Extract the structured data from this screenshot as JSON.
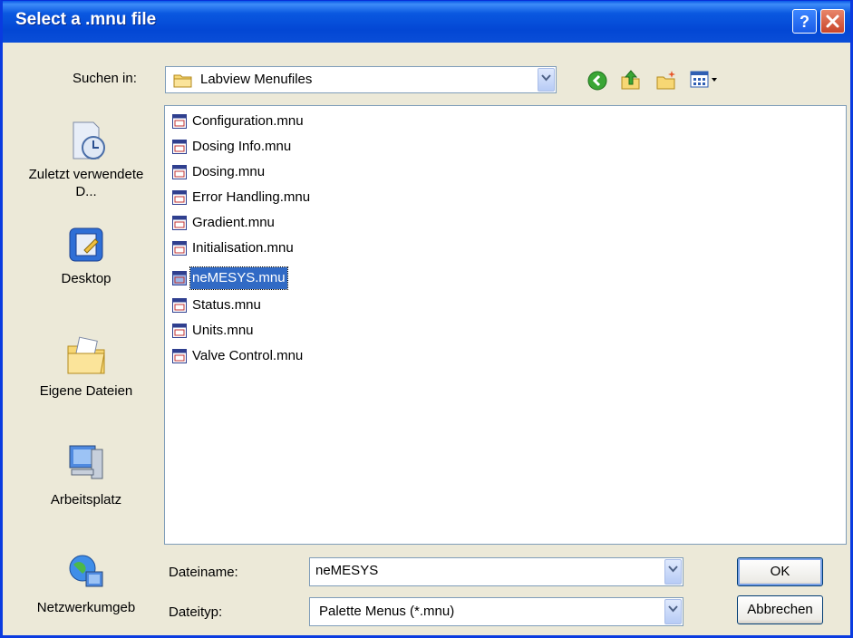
{
  "window": {
    "title": "Select a .mnu file"
  },
  "toolbar": {
    "look_in_label": "Suchen in:",
    "look_in_value": "Labview Menufiles"
  },
  "places": [
    {
      "label": "Zuletzt verwendete D...",
      "icon": "recent-documents-icon"
    },
    {
      "label": "Desktop",
      "icon": "desktop-icon"
    },
    {
      "label": "Eigene Dateien",
      "icon": "my-documents-icon"
    },
    {
      "label": "Arbeitsplatz",
      "icon": "my-computer-icon"
    },
    {
      "label": "Netzwerkumgeb",
      "icon": "network-icon"
    }
  ],
  "files": [
    {
      "name": "Configuration.mnu",
      "selected": false
    },
    {
      "name": "Dosing Info.mnu",
      "selected": false
    },
    {
      "name": "Dosing.mnu",
      "selected": false
    },
    {
      "name": "Error Handling.mnu",
      "selected": false
    },
    {
      "name": "Gradient.mnu",
      "selected": false
    },
    {
      "name": "Initialisation.mnu",
      "selected": false
    },
    {
      "name": "neMESYS.mnu",
      "selected": true
    },
    {
      "name": "Status.mnu",
      "selected": false
    },
    {
      "name": "Units.mnu",
      "selected": false
    },
    {
      "name": "Valve Control.mnu",
      "selected": false
    }
  ],
  "filename": {
    "label": "Dateiname:",
    "value": "neMESYS"
  },
  "filetype": {
    "label": "Dateityp:",
    "value": "Palette Menus (*.mnu)"
  },
  "buttons": {
    "ok": "OK",
    "cancel": "Abbrechen"
  },
  "colors": {
    "titlebar": "#0347d4",
    "selection": "#316ac5",
    "dialog_bg": "#ece9d8"
  }
}
